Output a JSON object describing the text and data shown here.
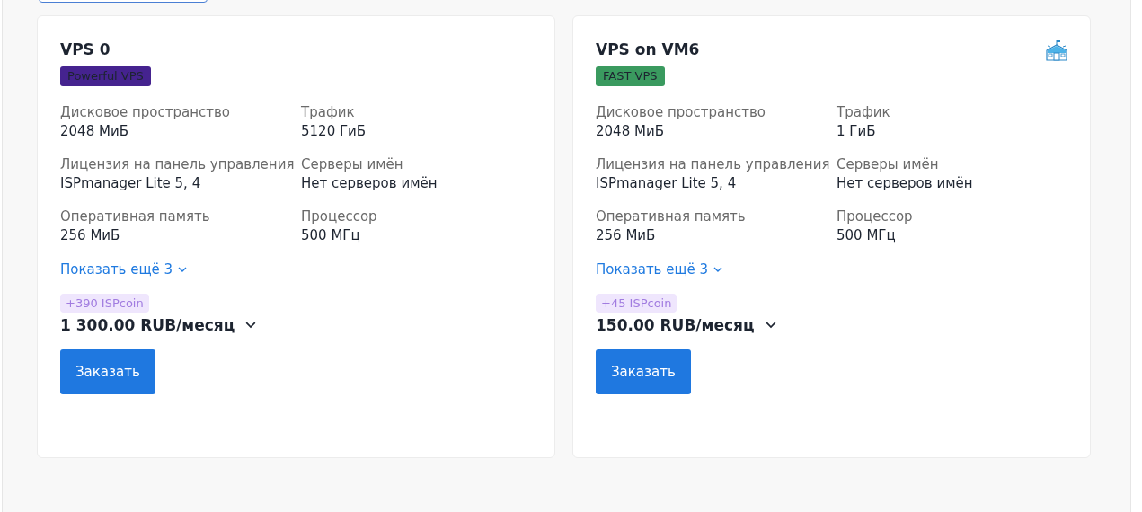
{
  "cards": [
    {
      "title": "VPS 0",
      "icon": false,
      "tag": {
        "label": "Powerful VPS",
        "color": "#45238f"
      },
      "specs": [
        {
          "label": "Дисковое пространство",
          "value": "2048 МиБ"
        },
        {
          "label": "Трафик",
          "value": "5120 ГиБ"
        },
        {
          "label": "Лицензия на панель управления",
          "value": "ISPmanager Lite 5, 4"
        },
        {
          "label": "Серверы имён",
          "value": "Нет серверов имён"
        },
        {
          "label": "Оперативная память",
          "value": "256 МиБ"
        },
        {
          "label": "Процессор",
          "value": "500 МГц"
        }
      ],
      "more": "Показать ещё 3",
      "coins": "+390 ISPcoin",
      "price": "1 300.00 RUB/месяц",
      "order": "Заказать"
    },
    {
      "title": "VPS on VM6",
      "icon": true,
      "tag": {
        "label": "FAST VPS",
        "color": "#3a9a5f"
      },
      "specs": [
        {
          "label": "Дисковое пространство",
          "value": "2048 МиБ"
        },
        {
          "label": "Трафик",
          "value": "1 ГиБ"
        },
        {
          "label": "Лицензия на панель управления",
          "value": "ISPmanager Lite 5, 4"
        },
        {
          "label": "Серверы имён",
          "value": "Нет серверов имён"
        },
        {
          "label": "Оперативная память",
          "value": "256 МиБ"
        },
        {
          "label": "Процессор",
          "value": "500 МГц"
        }
      ],
      "more": "Показать ещё 3",
      "coins": "+45 ISPcoin",
      "price": "150.00 RUB/месяц",
      "order": "Заказать"
    }
  ]
}
